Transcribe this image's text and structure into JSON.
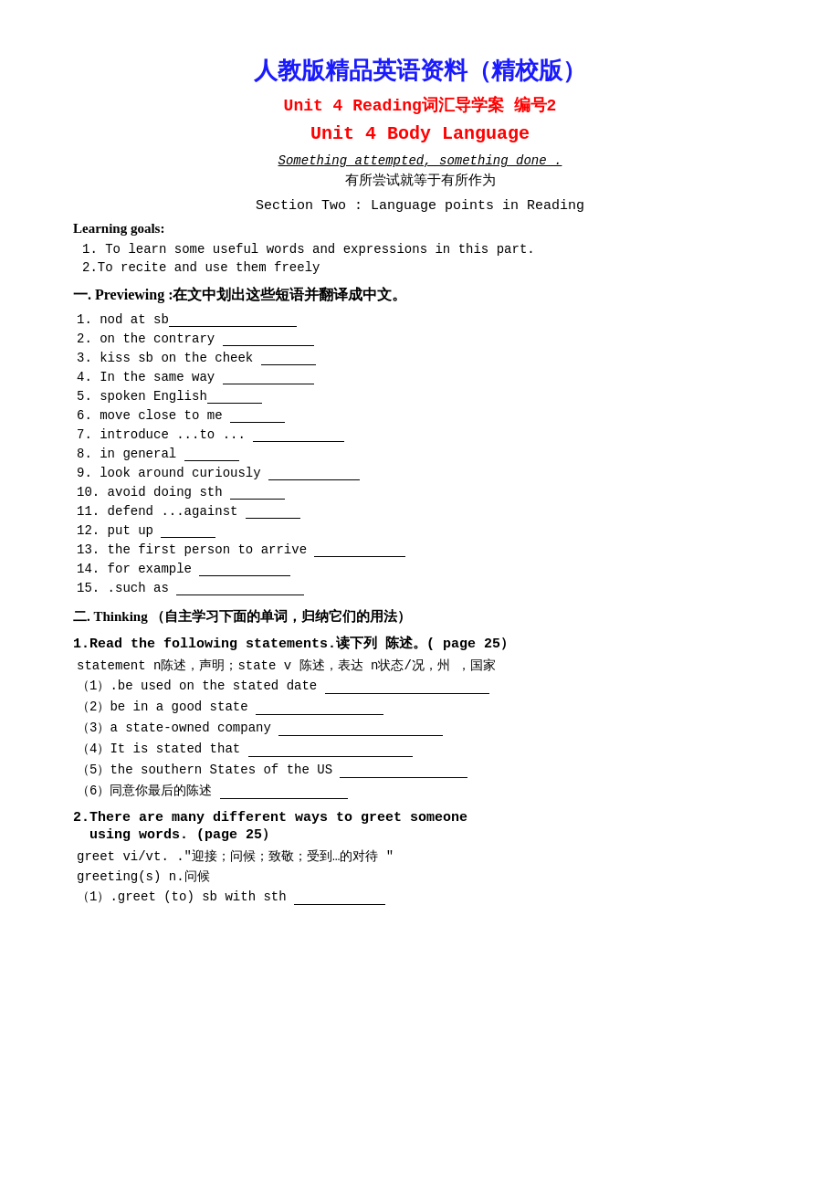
{
  "header": {
    "main_title": "人教版精品英语资料（精校版）",
    "sub_title": "Unit 4    Reading词汇导学案 编号2",
    "unit_title": "Unit 4      Body Language",
    "motto": "Something attempted, something done .",
    "motto_zh": "有所尝试就等于有所作为",
    "section_title": "Section Two :  Language points in Reading"
  },
  "learning_goals": {
    "title": "Learning goals:",
    "items": [
      "1. To learn some useful words and expressions in this part.",
      "2.To recite and use them freely"
    ]
  },
  "section_one": {
    "header": "一. Previewing :在文中划出这些短语并翻译成中文。",
    "items": [
      "1. nod at sb",
      "2. on the contrary",
      "3. kiss sb on the cheek",
      "4. In the same way",
      "5. spoken English",
      "6. move close to me",
      "7. introduce ...to ...",
      "8. in general",
      "9. look around curiously",
      "10. avoid doing sth",
      "11. defend ...against",
      "12. put up",
      "13. the first person to arrive",
      "14.  for example",
      "15. .such as"
    ],
    "blanks": [
      "lg",
      "md",
      "sm",
      "md",
      "sm",
      "sm",
      "md",
      "sm",
      "md",
      "sm",
      "sm",
      "sm",
      "md",
      "md",
      "lg"
    ]
  },
  "section_two": {
    "header": "二.  Thinking （自主学习下面的单词，归纳它们的用法）",
    "subsections": [
      {
        "title": "1.Read the following statements.读下列 陈述。( page 25）",
        "note": " statement n陈述，声明；state v 陈述，表达 n状态/况，州 ，国家",
        "exercises": [
          "（1）.be used on the stated date",
          "（2）be in a good state",
          "（3）a state-owned company",
          "（4）It is stated that",
          "（5）the southern States of the US",
          "（6）同意你最后的陈述"
        ],
        "blank_sizes": [
          "xl",
          "lg",
          "xl",
          "xl",
          "lg",
          "lg"
        ]
      },
      {
        "title": "2.There are many different ways to greet someone\n  using words.  (page 25）",
        "note1": " greet vi/vt. .\"迎接；问候；致敬；受到…的对待 \"",
        "note2": " greeting(s) n.问候",
        "exercises": [
          "（1）.greet (to) sb with sth"
        ],
        "blank_sizes": [
          "md"
        ]
      }
    ]
  }
}
